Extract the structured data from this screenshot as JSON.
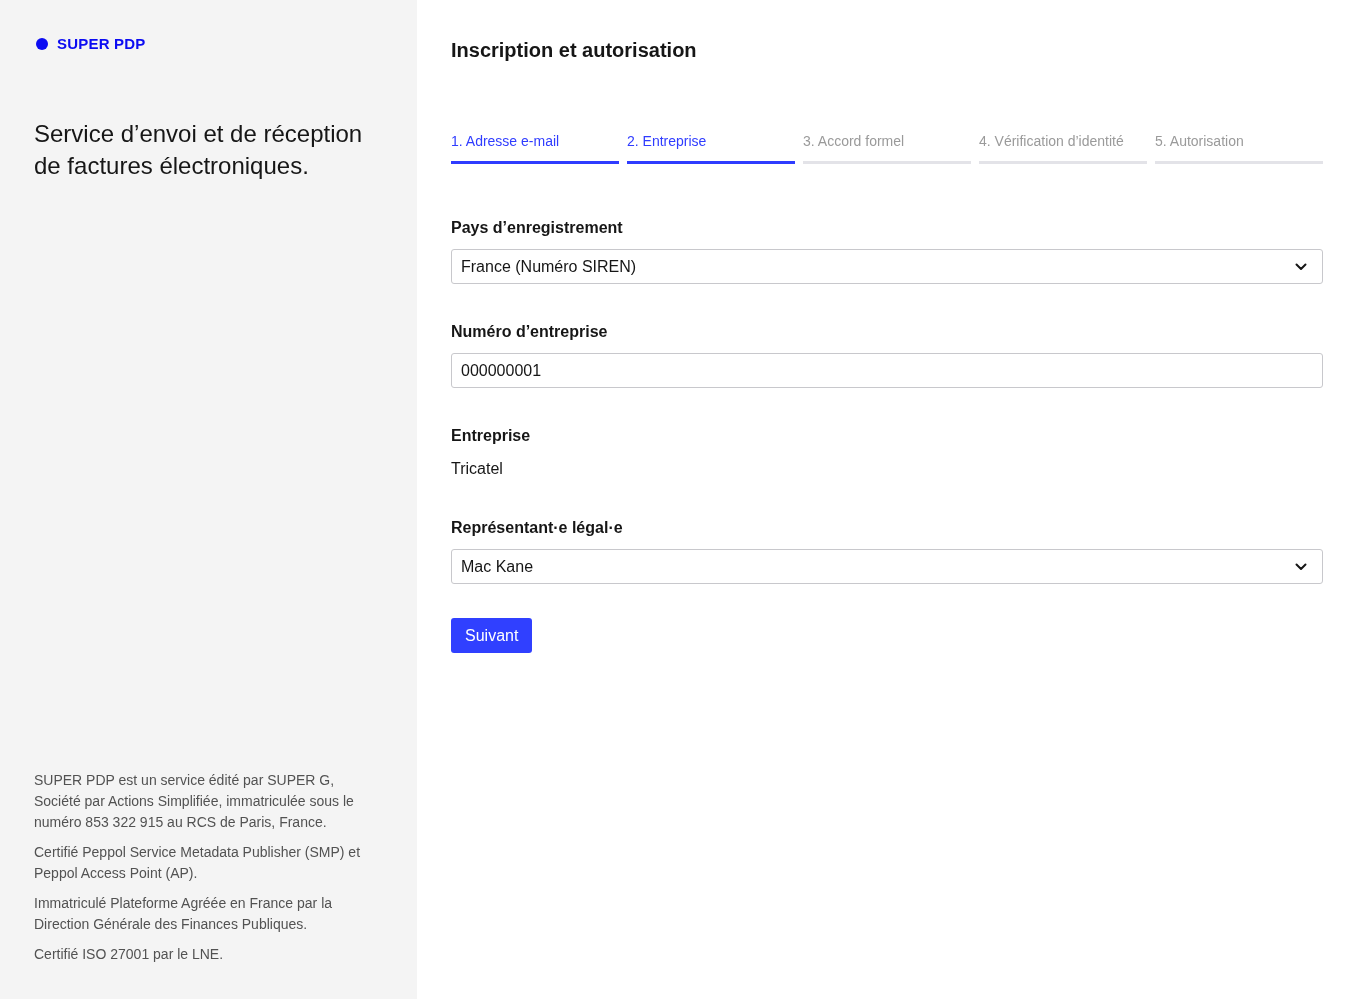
{
  "sidebar": {
    "logo": "SUPER PDP",
    "tagline": "Service d’envoi et de réception de factures électroniques.",
    "footer": [
      "SUPER PDP est un service édité par SUPER G, Société par Actions Simplifiée, immatriculée sous le numéro 853 322 915 au RCS de Paris, France.",
      "Certifié Peppol Service Metadata Publisher (SMP) et Peppol Access Point (AP).",
      "Immatriculé Plateforme Agréée en France par la Direction Générale des Finances Publiques.",
      "Certifié ISO 27001 par le LNE."
    ]
  },
  "main": {
    "title": "Inscription et autorisation",
    "steps": [
      {
        "label": "1. Adresse e-mail",
        "active": true
      },
      {
        "label": "2. Entreprise",
        "active": true
      },
      {
        "label": "3. Accord formel",
        "active": false
      },
      {
        "label": "4. Vérification d’identité",
        "active": false
      },
      {
        "label": "5. Autorisation",
        "active": false
      }
    ],
    "fields": [
      {
        "kind": "select",
        "label": "Pays d’enregistrement",
        "value": "France (Numéro SIREN)"
      },
      {
        "kind": "input",
        "label": "Numéro d’entreprise",
        "value": "000000001"
      },
      {
        "kind": "text",
        "label": "Entreprise",
        "value": "Tricatel"
      },
      {
        "kind": "select",
        "label": "Représentant·e légal·e",
        "value": "Mac Kane"
      }
    ],
    "submit": "Suivant"
  }
}
